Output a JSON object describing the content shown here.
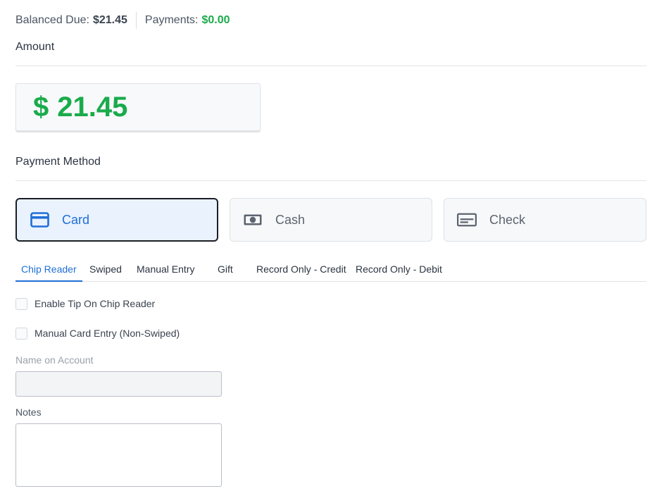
{
  "summary": {
    "balance_label": "Balanced Due:",
    "balance_value": "$21.45",
    "payments_label": "Payments:",
    "payments_value": "$0.00"
  },
  "amount": {
    "section_label": "Amount",
    "currency": "$",
    "value": "21.45"
  },
  "payment_method": {
    "section_label": "Payment Method",
    "options": [
      {
        "label": "Card",
        "icon": "credit-card-icon",
        "selected": true
      },
      {
        "label": "Cash",
        "icon": "cash-icon",
        "selected": false
      },
      {
        "label": "Check",
        "icon": "check-icon",
        "selected": false
      }
    ]
  },
  "tabs": [
    {
      "label": "Chip Reader",
      "active": true
    },
    {
      "label": "Swiped",
      "active": false
    },
    {
      "label": "Manual Entry",
      "active": false
    },
    {
      "label": "Gift",
      "active": false
    },
    {
      "label": "Record Only - Credit",
      "active": false
    },
    {
      "label": "Record Only - Debit",
      "active": false
    }
  ],
  "options": {
    "enable_tip_label": "Enable Tip On Chip Reader",
    "manual_entry_label": "Manual Card Entry (Non-Swiped)"
  },
  "form": {
    "name_label": "Name on Account",
    "name_value": "",
    "notes_label": "Notes",
    "notes_value": ""
  },
  "colors": {
    "accent": "#1f6fd6",
    "success": "#1aab4b",
    "selected_border": "#1b1f24",
    "selected_bg": "#eaf2fe"
  }
}
